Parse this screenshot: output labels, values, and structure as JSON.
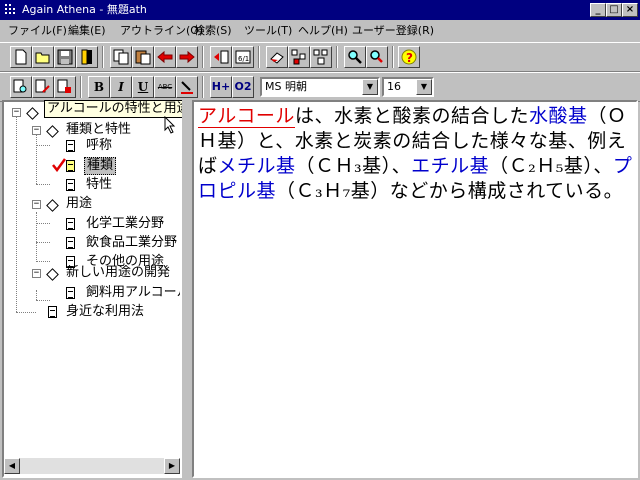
{
  "window": {
    "title": "Again Athena - 無題ath"
  },
  "menu": [
    {
      "label": "ファイル(F)"
    },
    {
      "label": "編集(E)"
    },
    {
      "label": "アウトライン(O)"
    },
    {
      "label": "検索(S)"
    },
    {
      "label": "ツール(T)"
    },
    {
      "label": "ヘルプ(H)"
    },
    {
      "label": "ユーザー登録(R)"
    }
  ],
  "format_toolbar": {
    "bold": "B",
    "italic": "I",
    "underline": "U",
    "strike": "ABC",
    "h_plus": "H+",
    "o2": "O2",
    "font_name": "MS 明朝",
    "font_size": "16"
  },
  "toolbar_icons": [
    "new-doc-icon",
    "open-icon",
    "save-icon",
    "bookmark-icon",
    "copy-icon",
    "paste-icon",
    "arrow-left-icon",
    "arrow-right-icon",
    "jump-back-icon",
    "calendar-icon",
    "eraser-icon",
    "outline-expand-icon",
    "outline-collapse-icon",
    "search-icon",
    "search-replace-icon",
    "help-icon"
  ],
  "tree": {
    "tooltip": "アルコールの特性と用途",
    "items": [
      {
        "label": "アルコールの特性と用途"
      },
      {
        "label": "種類と特性"
      },
      {
        "label": "呼称"
      },
      {
        "label": "種類"
      },
      {
        "label": "特性"
      },
      {
        "label": "用途"
      },
      {
        "label": "化学工業分野"
      },
      {
        "label": "飲食品工業分野"
      },
      {
        "label": "その他の用途"
      },
      {
        "label": "新しい用途の開発"
      },
      {
        "label": "飼料用アルコール"
      },
      {
        "label": "身近な利用法"
      }
    ]
  },
  "content": {
    "alcohol": "アルコール",
    "t1": "は、水素と酸素の結合した",
    "hydroxyl": "水酸基",
    "t2": "（ＯＨ基）と、水素と炭素の結合した様々な基、例えば",
    "methyl": "メチル基",
    "t3": "（ＣＨ₃基）、",
    "ethyl": "エチル基",
    "t4": "（Ｃ₂Ｈ₅基）、",
    "propyl": "プロピル基",
    "t5": "（Ｃ₃Ｈ₇基）などから構成されている。"
  },
  "colors": {
    "title_bar": "#000080",
    "link": "#0000cc",
    "highlight": "#e00000",
    "tooltip": "#ffffe1"
  }
}
